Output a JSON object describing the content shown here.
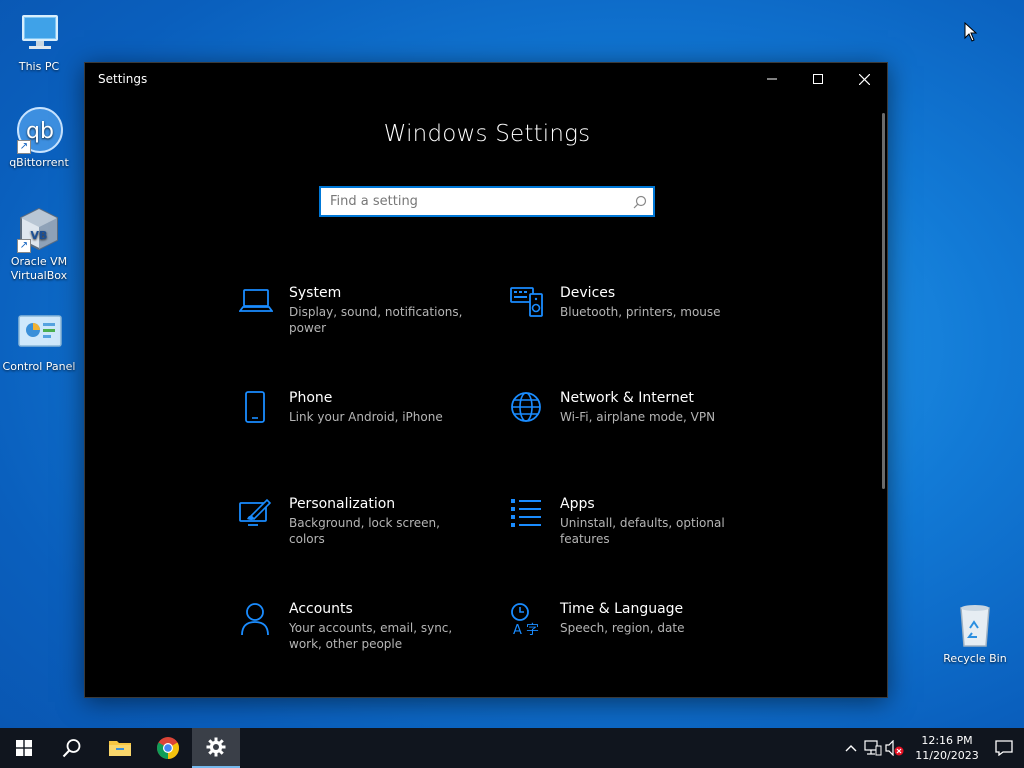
{
  "desktop": {
    "icons": [
      {
        "label": "This PC"
      },
      {
        "label": "qBittorrent"
      },
      {
        "label": "Oracle VM VirtualBox"
      },
      {
        "label": "Control Panel"
      },
      {
        "label": "Recycle Bin"
      }
    ]
  },
  "window": {
    "title": "Settings",
    "heading": "Windows Settings",
    "search": {
      "placeholder": "Find a setting"
    },
    "accent_color": "#0078d7",
    "categories": [
      {
        "name": "System",
        "desc": "Display, sound, notifications, power",
        "icon": "laptop-icon"
      },
      {
        "name": "Devices",
        "desc": "Bluetooth, printers, mouse",
        "icon": "devices-icon"
      },
      {
        "name": "Phone",
        "desc": "Link your Android, iPhone",
        "icon": "phone-icon"
      },
      {
        "name": "Network & Internet",
        "desc": "Wi-Fi, airplane mode, VPN",
        "icon": "globe-icon"
      },
      {
        "name": "Personalization",
        "desc": "Background, lock screen, colors",
        "icon": "paintbrush-icon"
      },
      {
        "name": "Apps",
        "desc": "Uninstall, defaults, optional features",
        "icon": "apps-list-icon"
      },
      {
        "name": "Accounts",
        "desc": "Your accounts, email, sync, work, other people",
        "icon": "person-icon"
      },
      {
        "name": "Time & Language",
        "desc": "Speech, region, date",
        "icon": "time-language-icon"
      }
    ]
  },
  "taskbar": {
    "clock": {
      "time": "12:16 PM",
      "date": "11/20/2023"
    }
  }
}
